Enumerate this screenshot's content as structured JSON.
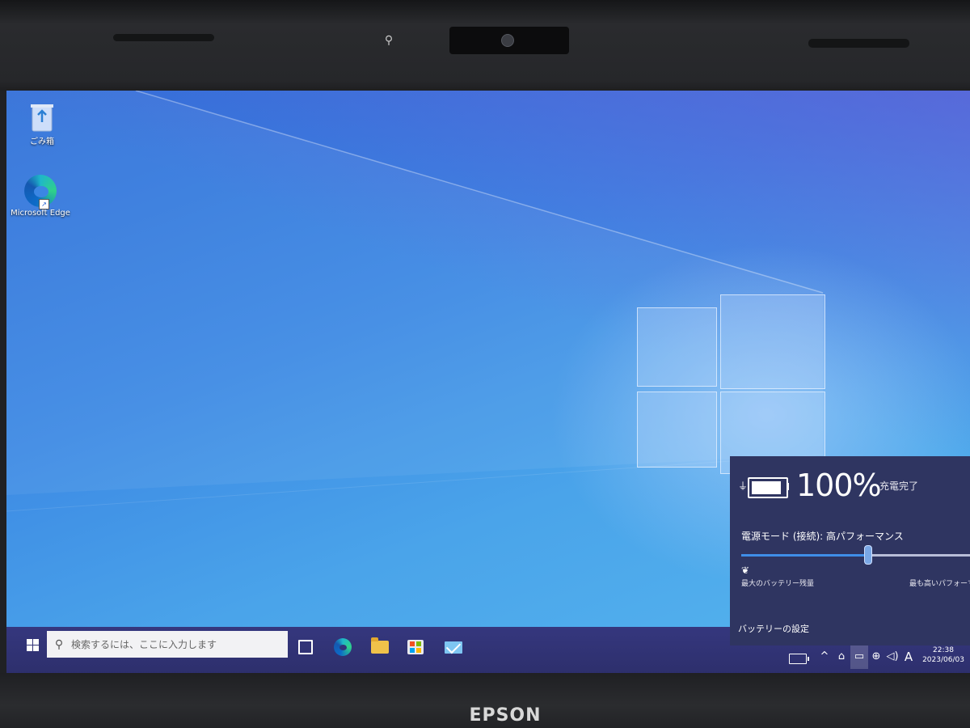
{
  "device": {
    "brand": "EPSON"
  },
  "desktop": {
    "icons": [
      {
        "label": "ごみ箱",
        "icon": "recycle-bin-icon"
      },
      {
        "label": "Microsoft Edge",
        "icon": "edge-icon"
      }
    ]
  },
  "taskbar": {
    "search_placeholder": "検索するには、ここに入力します",
    "pinned": [
      "task-view-icon",
      "edge-icon",
      "file-explorer-icon",
      "store-icon",
      "mail-icon"
    ],
    "tray": {
      "chevron": "^",
      "language": "A",
      "clock_time": "22:38",
      "clock_date": "2023/06/03"
    }
  },
  "battery_flyout": {
    "percent_label": "100%",
    "status": "充電完了",
    "power_mode_label": "電源モード (接続): 高パフォーマンス",
    "slider_level": 0.55,
    "slider_min_label": "最大のバッテリー残量",
    "slider_max_label": "最も高いパフォーマンス",
    "settings_link": "バッテリーの設定",
    "battery_level": 1.0
  },
  "colors": {
    "taskbar": "#2d2f6c",
    "flyout": "#2f3561",
    "accent": "#3f8ee8"
  }
}
